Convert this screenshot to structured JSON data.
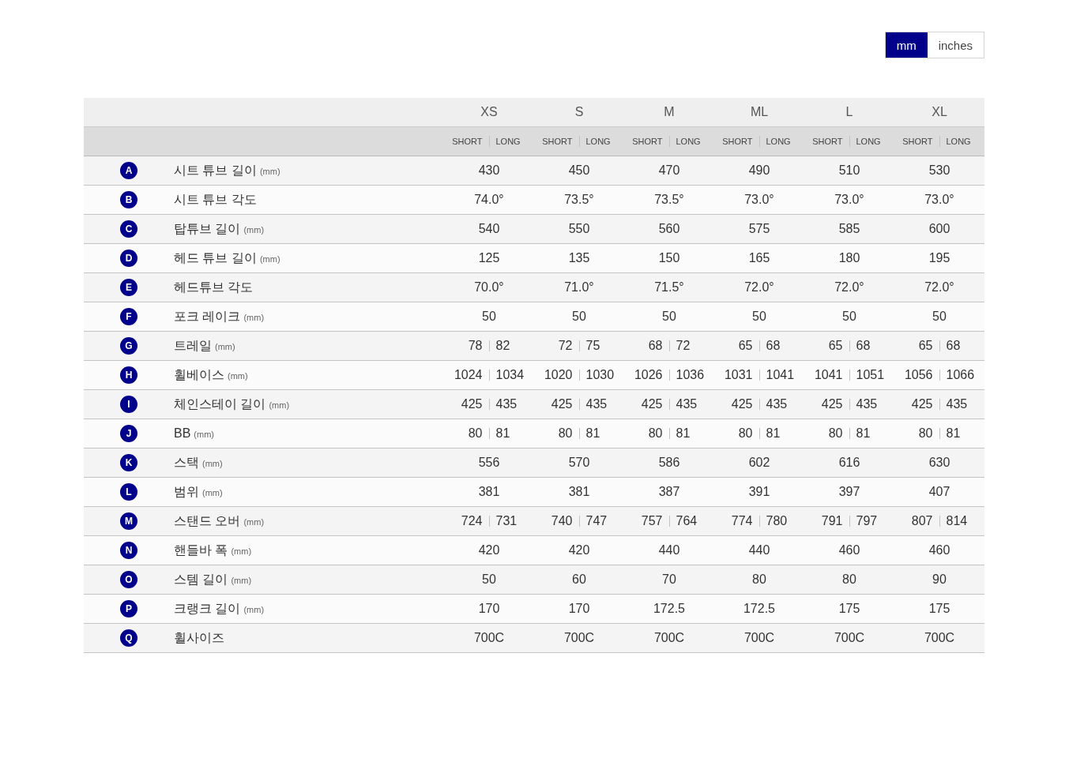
{
  "units": [
    {
      "label": "mm",
      "selected": true
    },
    {
      "label": "inches",
      "selected": false
    }
  ],
  "sizes": [
    "XS",
    "S",
    "M",
    "ML",
    "L",
    "XL"
  ],
  "subheaders": [
    [
      "SHORT",
      "LONG"
    ],
    [
      "SHORT",
      "LONG"
    ],
    [
      "SHORT",
      "LONG"
    ],
    [
      "SHORT",
      "LONG"
    ],
    [
      "SHORT",
      "LONG"
    ],
    [
      "SHORT",
      "LONG"
    ]
  ],
  "rows": [
    {
      "letter": "A",
      "label": "시트 튜브 길이",
      "unit": "(mm)",
      "cells": [
        [
          "430"
        ],
        [
          "450"
        ],
        [
          "470"
        ],
        [
          "490"
        ],
        [
          "510"
        ],
        [
          "530"
        ]
      ]
    },
    {
      "letter": "B",
      "label": "시트 튜브 각도",
      "cells": [
        [
          "74.0°"
        ],
        [
          "73.5°"
        ],
        [
          "73.5°"
        ],
        [
          "73.0°"
        ],
        [
          "73.0°"
        ],
        [
          "73.0°"
        ]
      ]
    },
    {
      "letter": "C",
      "label": "탑튜브 길이",
      "unit": "(mm)",
      "cells": [
        [
          "540"
        ],
        [
          "550"
        ],
        [
          "560"
        ],
        [
          "575"
        ],
        [
          "585"
        ],
        [
          "600"
        ]
      ]
    },
    {
      "letter": "D",
      "label": "헤드 튜브 길이",
      "unit": "(mm)",
      "cells": [
        [
          "125"
        ],
        [
          "135"
        ],
        [
          "150"
        ],
        [
          "165"
        ],
        [
          "180"
        ],
        [
          "195"
        ]
      ]
    },
    {
      "letter": "E",
      "label": "헤드튜브 각도",
      "cells": [
        [
          "70.0°"
        ],
        [
          "71.0°"
        ],
        [
          "71.5°"
        ],
        [
          "72.0°"
        ],
        [
          "72.0°"
        ],
        [
          "72.0°"
        ]
      ]
    },
    {
      "letter": "F",
      "label": "포크 레이크",
      "unit": "(mm)",
      "cells": [
        [
          "50"
        ],
        [
          "50"
        ],
        [
          "50"
        ],
        [
          "50"
        ],
        [
          "50"
        ],
        [
          "50"
        ]
      ]
    },
    {
      "letter": "G",
      "label": "트레일",
      "unit": "(mm)",
      "cells": [
        [
          "78",
          "82"
        ],
        [
          "72",
          "75"
        ],
        [
          "68",
          "72"
        ],
        [
          "65",
          "68"
        ],
        [
          "65",
          "68"
        ],
        [
          "65",
          "68"
        ]
      ]
    },
    {
      "letter": "H",
      "label": "휠베이스",
      "unit": "(mm)",
      "cells": [
        [
          "1024",
          "1034"
        ],
        [
          "1020",
          "1030"
        ],
        [
          "1026",
          "1036"
        ],
        [
          "1031",
          "1041"
        ],
        [
          "1041",
          "1051"
        ],
        [
          "1056",
          "1066"
        ]
      ]
    },
    {
      "letter": "I",
      "label": "체인스테이 길이",
      "unit": "(mm)",
      "cells": [
        [
          "425",
          "435"
        ],
        [
          "425",
          "435"
        ],
        [
          "425",
          "435"
        ],
        [
          "425",
          "435"
        ],
        [
          "425",
          "435"
        ],
        [
          "425",
          "435"
        ]
      ]
    },
    {
      "letter": "J",
      "label": "BB",
      "unit": "(mm)",
      "cells": [
        [
          "80",
          "81"
        ],
        [
          "80",
          "81"
        ],
        [
          "80",
          "81"
        ],
        [
          "80",
          "81"
        ],
        [
          "80",
          "81"
        ],
        [
          "80",
          "81"
        ]
      ]
    },
    {
      "letter": "K",
      "label": "스택",
      "unit": "(mm)",
      "cells": [
        [
          "556"
        ],
        [
          "570"
        ],
        [
          "586"
        ],
        [
          "602"
        ],
        [
          "616"
        ],
        [
          "630"
        ]
      ]
    },
    {
      "letter": "L",
      "label": "범위",
      "unit": "(mm)",
      "cells": [
        [
          "381"
        ],
        [
          "381"
        ],
        [
          "387"
        ],
        [
          "391"
        ],
        [
          "397"
        ],
        [
          "407"
        ]
      ]
    },
    {
      "letter": "M",
      "label": "스탠드 오버",
      "unit": "(mm)",
      "cells": [
        [
          "724",
          "731"
        ],
        [
          "740",
          "747"
        ],
        [
          "757",
          "764"
        ],
        [
          "774",
          "780"
        ],
        [
          "791",
          "797"
        ],
        [
          "807",
          "814"
        ]
      ]
    },
    {
      "letter": "N",
      "label": "핸들바 폭",
      "unit": "(mm)",
      "cells": [
        [
          "420"
        ],
        [
          "420"
        ],
        [
          "440"
        ],
        [
          "440"
        ],
        [
          "460"
        ],
        [
          "460"
        ]
      ]
    },
    {
      "letter": "O",
      "label": "스템 길이",
      "unit": "(mm)",
      "cells": [
        [
          "50"
        ],
        [
          "60"
        ],
        [
          "70"
        ],
        [
          "80"
        ],
        [
          "80"
        ],
        [
          "90"
        ]
      ]
    },
    {
      "letter": "P",
      "label": "크랭크 길이",
      "unit": "(mm)",
      "cells": [
        [
          "170"
        ],
        [
          "170"
        ],
        [
          "172.5"
        ],
        [
          "172.5"
        ],
        [
          "175"
        ],
        [
          "175"
        ]
      ]
    },
    {
      "letter": "Q",
      "label": "휠사이즈",
      "cells": [
        [
          "700C"
        ],
        [
          "700C"
        ],
        [
          "700C"
        ],
        [
          "700C"
        ],
        [
          "700C"
        ],
        [
          "700C"
        ]
      ]
    }
  ]
}
